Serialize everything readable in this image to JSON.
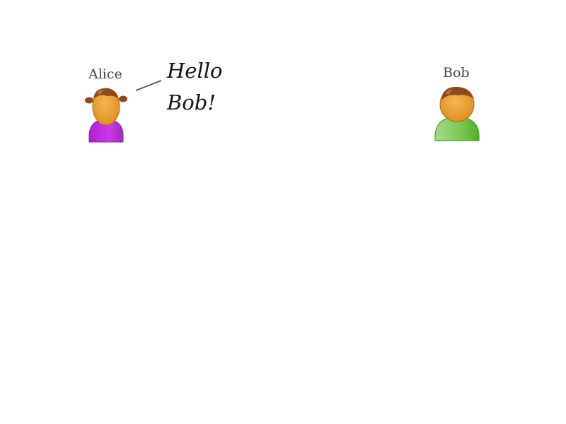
{
  "people": {
    "alice": {
      "name": "Alice",
      "shirt_color": "#c22be0",
      "icon": "person-female-icon"
    },
    "bob": {
      "name": "Bob",
      "shirt_color": "#6cbf3a",
      "icon": "person-male-icon"
    }
  },
  "speech": {
    "line1": "Hello",
    "line2": "Bob!"
  },
  "colors": {
    "skin": "#eea23a",
    "hair": "#8a4a1c"
  }
}
